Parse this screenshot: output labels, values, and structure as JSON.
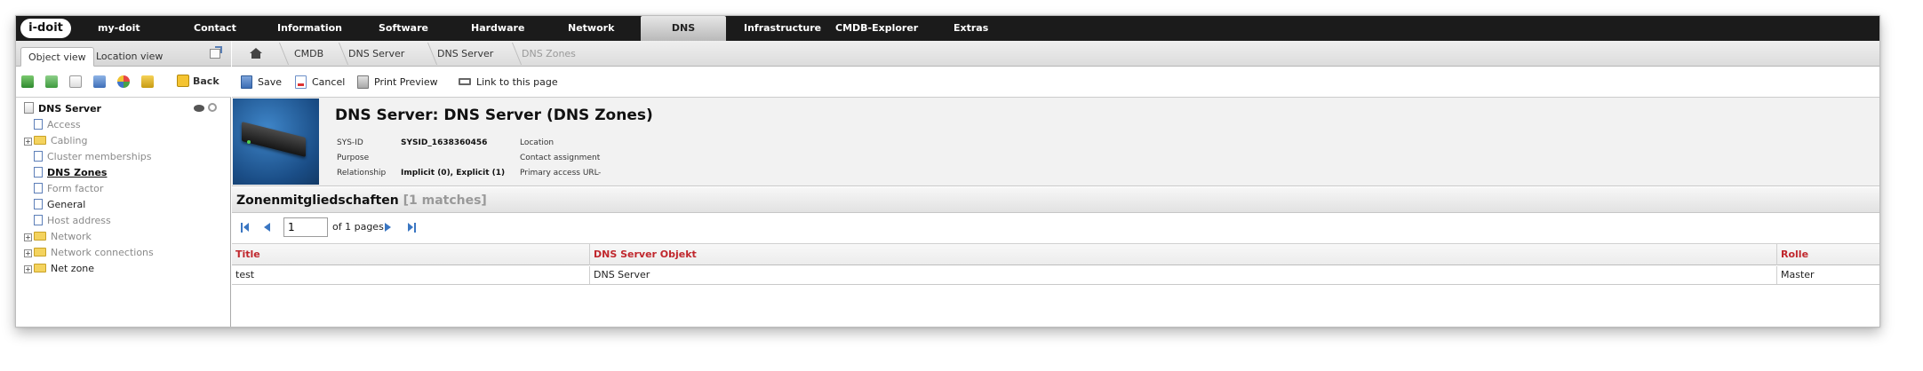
{
  "logo": "i-doit",
  "nav": {
    "items": [
      {
        "label": "my-doit"
      },
      {
        "label": "Contact"
      },
      {
        "label": "Information"
      },
      {
        "label": "Software"
      },
      {
        "label": "Hardware"
      },
      {
        "label": "Network"
      },
      {
        "label": "DNS",
        "active": true
      },
      {
        "label": "Infrastructure"
      },
      {
        "label": "CMDB-Explorer"
      },
      {
        "label": "Extras"
      }
    ]
  },
  "left": {
    "tabs": {
      "object_view": "Object view",
      "location_view": "Location view"
    },
    "back_label": "Back",
    "tree": {
      "root": "DNS Server",
      "items": [
        {
          "label": "Access",
          "type": "doc",
          "style": "gray"
        },
        {
          "label": "Cabling",
          "type": "folder",
          "style": "gray",
          "expandable": true
        },
        {
          "label": "Cluster memberships",
          "type": "doc",
          "style": "gray"
        },
        {
          "label": "DNS Zones",
          "type": "doc",
          "style": "active"
        },
        {
          "label": "Form factor",
          "type": "doc",
          "style": "gray"
        },
        {
          "label": "General",
          "type": "doc",
          "style": "dark"
        },
        {
          "label": "Host address",
          "type": "doc",
          "style": "gray"
        },
        {
          "label": "Network",
          "type": "folder",
          "style": "gray",
          "expandable": true
        },
        {
          "label": "Network connections",
          "type": "folder",
          "style": "gray",
          "expandable": true
        },
        {
          "label": "Net zone",
          "type": "folder",
          "style": "dark",
          "expandable": true
        }
      ]
    }
  },
  "breadcrumb": [
    "CMDB",
    "DNS Server",
    "DNS Server",
    "DNS Zones"
  ],
  "actions": {
    "save": "Save",
    "cancel": "Cancel",
    "print": "Print Preview",
    "link": "Link to this page"
  },
  "object": {
    "title": "DNS Server: DNS Server (DNS Zones)",
    "sysid_label": "SYS-ID",
    "sysid_value": "SYSID_1638360456",
    "purpose_label": "Purpose",
    "relationship_label": "Relationship",
    "relationship_value": "Implicit (0), Explicit (1)",
    "location_label": "Location",
    "contact_label": "Contact assignment",
    "access_url_label": "Primary access URL",
    "access_url_value": "-"
  },
  "section": {
    "title": "Zonenmitgliedschaften",
    "count": "[1 matches]"
  },
  "pager": {
    "page": "1",
    "of_text": "of 1 pages"
  },
  "table": {
    "columns": [
      "Title",
      "DNS Server Objekt",
      "Rolle"
    ],
    "rows": [
      [
        "test",
        "DNS Server",
        "Master"
      ]
    ]
  },
  "colors": {
    "nav_bg": "#1b1b1b",
    "header_red": "#c0272d",
    "link_blue": "#3a76c2"
  }
}
